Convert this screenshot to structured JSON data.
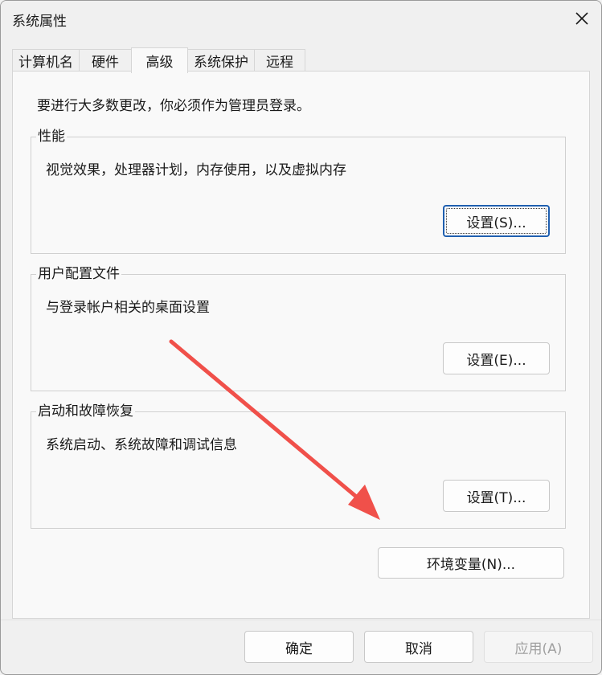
{
  "window": {
    "title": "系统属性"
  },
  "tabs": [
    {
      "label": "计算机名"
    },
    {
      "label": "硬件"
    },
    {
      "label": "高级"
    },
    {
      "label": "系统保护"
    },
    {
      "label": "远程"
    }
  ],
  "active_tab": "高级",
  "panel": {
    "notice": "要进行大多数更改，你必须作为管理员登录。",
    "groups": [
      {
        "title": "性能",
        "description": "视觉效果，处理器计划，内存使用，以及虚拟内存",
        "button": "设置(S)..."
      },
      {
        "title": "用户配置文件",
        "description": "与登录帐户相关的桌面设置",
        "button": "设置(E)..."
      },
      {
        "title": "启动和故障恢复",
        "description": "系统启动、系统故障和调试信息",
        "button": "设置(T)..."
      }
    ],
    "env_button": "环境变量(N)..."
  },
  "footer": {
    "ok": "确定",
    "cancel": "取消",
    "apply": "应用(A)"
  },
  "icons": {
    "close": "close-icon",
    "annotation": "red-arrow-annotation"
  },
  "colors": {
    "focus_border": "#1f5fb0",
    "arrow": "#f0504a",
    "disabled_text": "#a0a0a0"
  }
}
